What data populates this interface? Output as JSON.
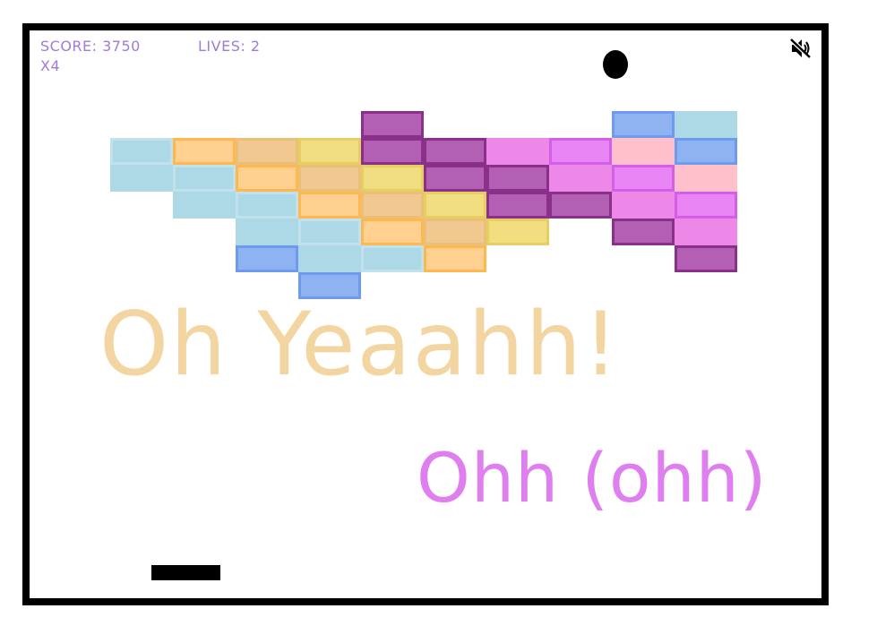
{
  "hud": {
    "score_text": "SCORE: 3750",
    "lives_text": "LIVES: 2",
    "multiplier_text": "X4",
    "color": "#a07bd8"
  },
  "controls": {
    "mute_icon": "speaker-muted-icon",
    "mute_state": "muted"
  },
  "callouts": {
    "big": {
      "text": "Oh Yeaahh!",
      "color": "#f3d5a1"
    },
    "small": {
      "text": "Ohh (ohh)",
      "color": "#df7fef"
    }
  },
  "palette": {
    "lightblue": {
      "fill": "#add8e6",
      "outline": "#c1e2ec"
    },
    "orange": {
      "fill": "#ffd090",
      "outline": "#ffb84d"
    },
    "tan": {
      "fill": "#f0c890",
      "outline": "#e8c07a"
    },
    "yellow": {
      "fill": "#f0de80",
      "outline": "#e6cf60"
    },
    "plum": {
      "fill": "#b35fb3",
      "outline": "#8a2f8a"
    },
    "pink": {
      "fill": "#ee88e8",
      "outline": "#e071e0"
    },
    "violet": {
      "fill": "#e884f3",
      "outline": "#d35fe8"
    },
    "rose": {
      "fill": "#ffc0cc",
      "outline": "#ffc0cc"
    },
    "blue": {
      "fill": "#8fb3f0",
      "outline": "#6e9af0"
    }
  },
  "bricks": [
    {
      "col": 4,
      "row": 0,
      "color": "plum",
      "outlined": true
    },
    {
      "col": 8,
      "row": 0,
      "color": "blue",
      "outlined": true
    },
    {
      "col": 9,
      "row": 0,
      "color": "lightblue",
      "outlined": false
    },
    {
      "col": 0,
      "row": 1,
      "color": "lightblue",
      "outlined": true
    },
    {
      "col": 1,
      "row": 1,
      "color": "orange",
      "outlined": true
    },
    {
      "col": 2,
      "row": 1,
      "color": "tan",
      "outlined": true
    },
    {
      "col": 3,
      "row": 1,
      "color": "yellow",
      "outlined": true
    },
    {
      "col": 4,
      "row": 1,
      "color": "plum",
      "outlined": true
    },
    {
      "col": 5,
      "row": 1,
      "color": "plum",
      "outlined": true
    },
    {
      "col": 6,
      "row": 1,
      "color": "pink",
      "outlined": false
    },
    {
      "col": 7,
      "row": 1,
      "color": "violet",
      "outlined": true
    },
    {
      "col": 8,
      "row": 1,
      "color": "rose",
      "outlined": false
    },
    {
      "col": 9,
      "row": 1,
      "color": "blue",
      "outlined": true
    },
    {
      "col": 0,
      "row": 2,
      "color": "lightblue",
      "outlined": false
    },
    {
      "col": 1,
      "row": 2,
      "color": "lightblue",
      "outlined": true
    },
    {
      "col": 2,
      "row": 2,
      "color": "orange",
      "outlined": true
    },
    {
      "col": 3,
      "row": 2,
      "color": "tan",
      "outlined": true
    },
    {
      "col": 4,
      "row": 2,
      "color": "yellow",
      "outlined": true
    },
    {
      "col": 5,
      "row": 2,
      "color": "plum",
      "outlined": true
    },
    {
      "col": 6,
      "row": 2,
      "color": "plum",
      "outlined": true
    },
    {
      "col": 7,
      "row": 2,
      "color": "pink",
      "outlined": false
    },
    {
      "col": 8,
      "row": 2,
      "color": "violet",
      "outlined": true
    },
    {
      "col": 9,
      "row": 2,
      "color": "rose",
      "outlined": false
    },
    {
      "col": 1,
      "row": 3,
      "color": "lightblue",
      "outlined": false
    },
    {
      "col": 2,
      "row": 3,
      "color": "lightblue",
      "outlined": true
    },
    {
      "col": 3,
      "row": 3,
      "color": "orange",
      "outlined": true
    },
    {
      "col": 4,
      "row": 3,
      "color": "tan",
      "outlined": true
    },
    {
      "col": 5,
      "row": 3,
      "color": "yellow",
      "outlined": true
    },
    {
      "col": 6,
      "row": 3,
      "color": "plum",
      "outlined": true
    },
    {
      "col": 7,
      "row": 3,
      "color": "plum",
      "outlined": true
    },
    {
      "col": 8,
      "row": 3,
      "color": "pink",
      "outlined": false
    },
    {
      "col": 9,
      "row": 3,
      "color": "violet",
      "outlined": true
    },
    {
      "col": 2,
      "row": 4,
      "color": "lightblue",
      "outlined": false
    },
    {
      "col": 3,
      "row": 4,
      "color": "lightblue",
      "outlined": true
    },
    {
      "col": 4,
      "row": 4,
      "color": "orange",
      "outlined": true
    },
    {
      "col": 5,
      "row": 4,
      "color": "tan",
      "outlined": true
    },
    {
      "col": 6,
      "row": 4,
      "color": "yellow",
      "outlined": true
    },
    {
      "col": 8,
      "row": 4,
      "color": "plum",
      "outlined": true
    },
    {
      "col": 9,
      "row": 4,
      "color": "pink",
      "outlined": false
    },
    {
      "col": 2,
      "row": 5,
      "color": "blue",
      "outlined": true
    },
    {
      "col": 3,
      "row": 5,
      "color": "lightblue",
      "outlined": false
    },
    {
      "col": 4,
      "row": 5,
      "color": "lightblue",
      "outlined": true
    },
    {
      "col": 5,
      "row": 5,
      "color": "orange",
      "outlined": true
    },
    {
      "col": 9,
      "row": 5,
      "color": "plum",
      "outlined": true
    },
    {
      "col": 3,
      "row": 6,
      "color": "blue",
      "outlined": true
    }
  ]
}
